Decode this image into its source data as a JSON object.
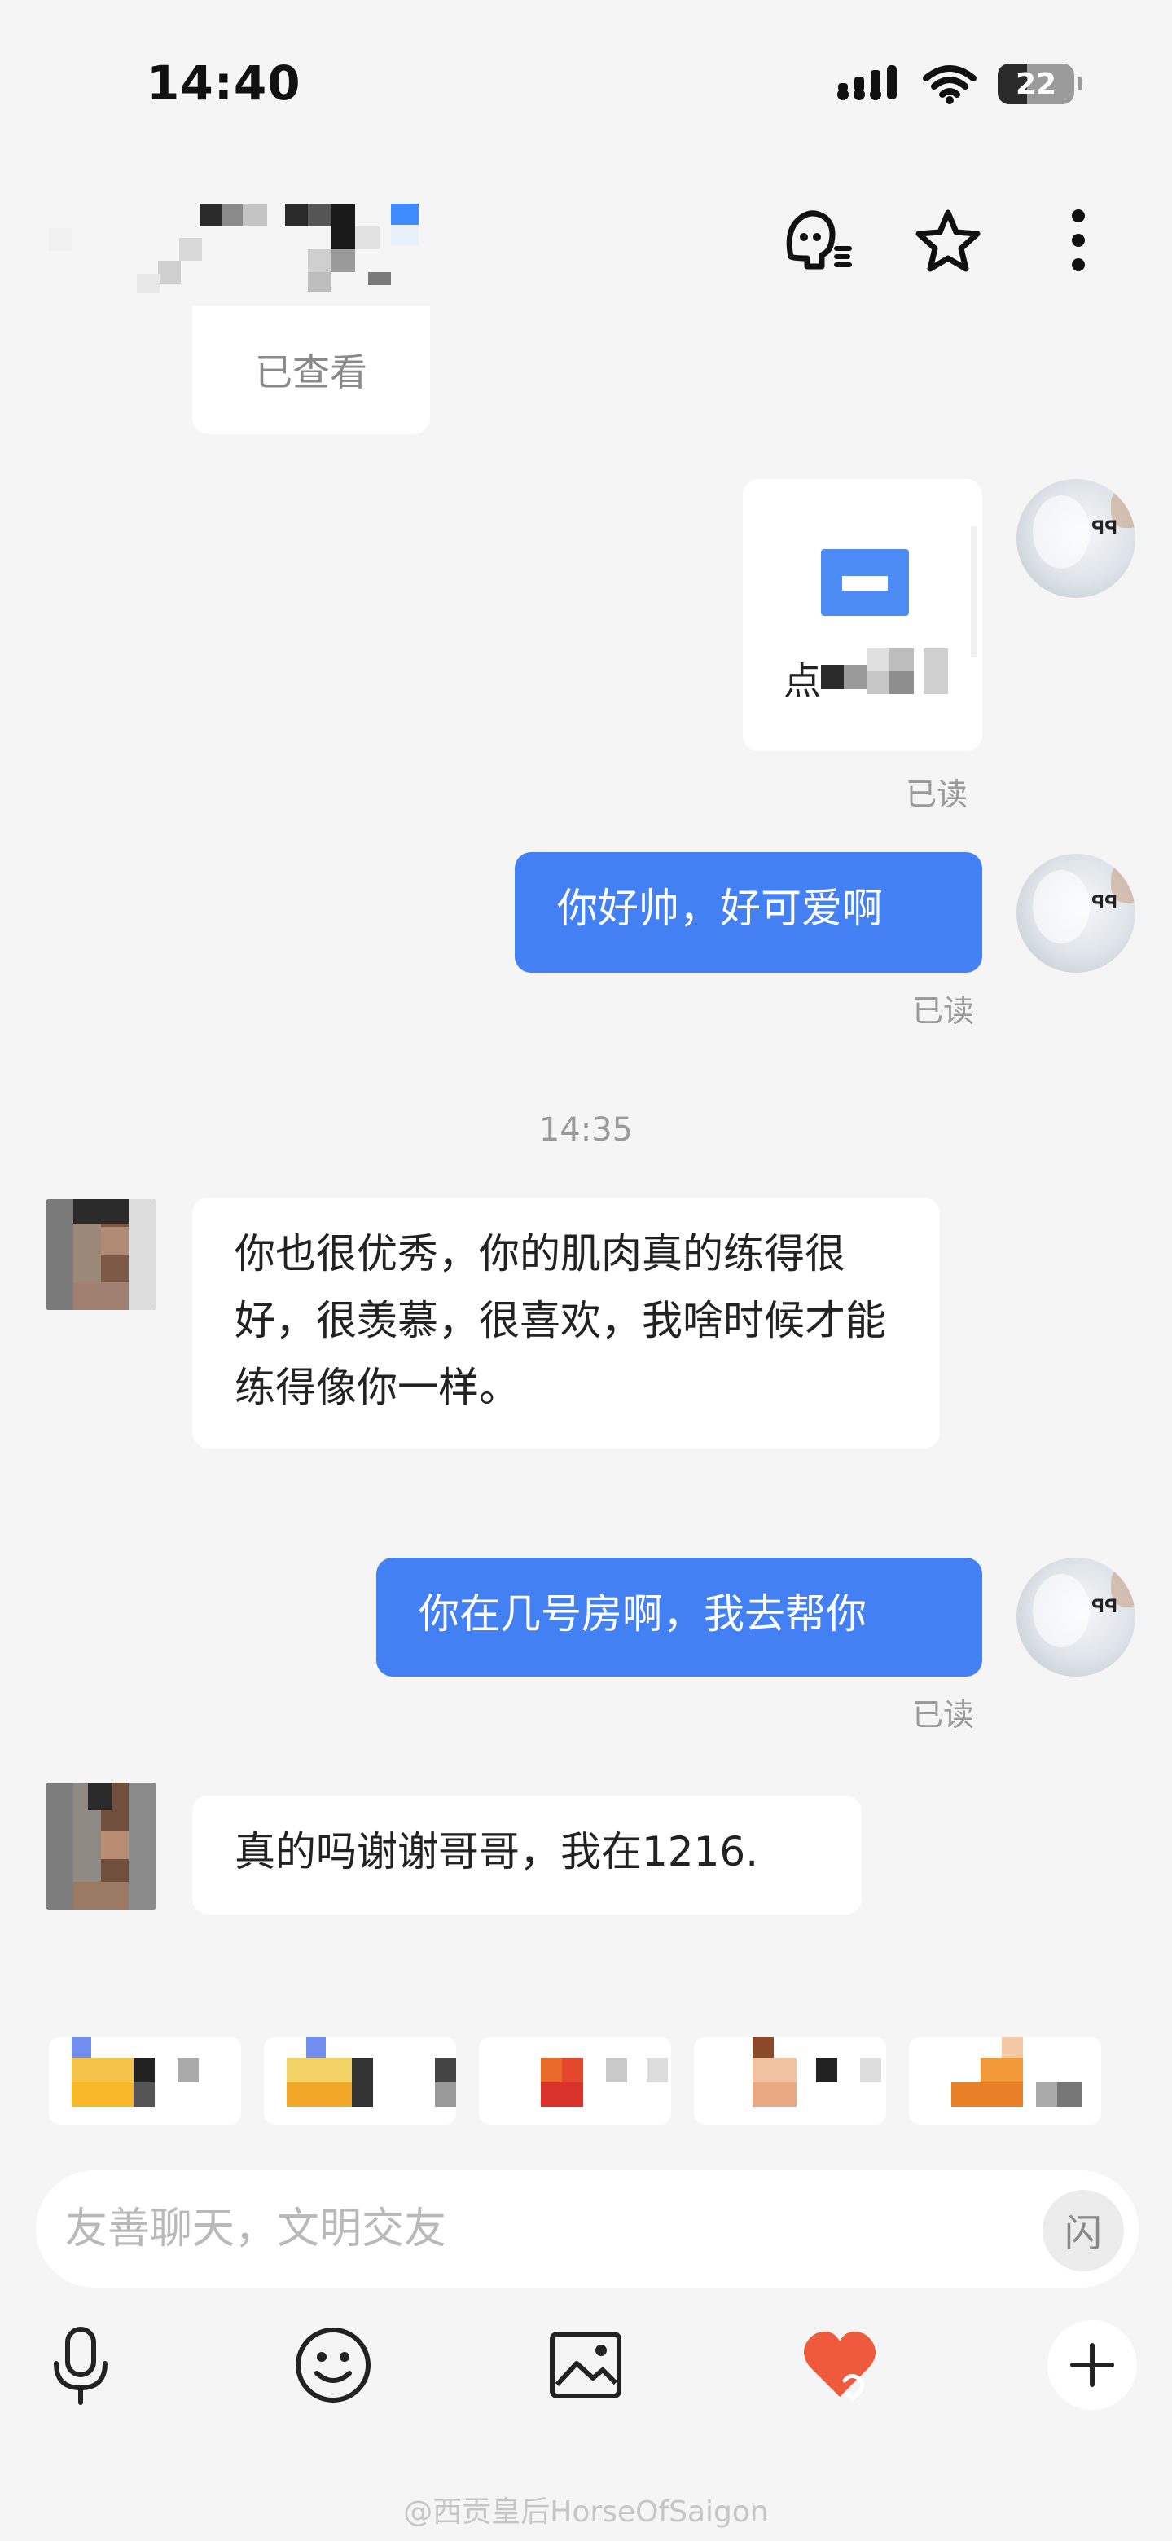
{
  "status_bar": {
    "time": "14:40",
    "battery_level": "22"
  },
  "header": {
    "actions": [
      "tone-icon",
      "star-icon",
      "more-icon"
    ]
  },
  "chat": {
    "viewed_label": "已查看",
    "card_label": "点",
    "read_label": "已读",
    "timestamp": "14:35",
    "messages": [
      {
        "from": "me",
        "text": "你好帅，好可爱啊",
        "status": "已读"
      },
      {
        "from": "them",
        "text": "你也很优秀，你的肌肉真的练得很好，很羡慕，很喜欢，我啥时候才能练得像你一样。"
      },
      {
        "from": "me",
        "text": "你在几号房啊，我去帮你",
        "status": "已读"
      },
      {
        "from": "them",
        "text": "真的吗谢谢哥哥，我在1216."
      }
    ]
  },
  "input": {
    "placeholder": "友善聊天，文明交友",
    "flash_label": "闪"
  },
  "toolbar": {
    "items": [
      "microphone-icon",
      "emoji-icon",
      "image-icon",
      "heart-icon",
      "plus-icon"
    ]
  },
  "watermark": "@西贡皇后HorseOfSaigon",
  "colors": {
    "accent": "#4280f4",
    "background": "#f5f5f5",
    "heart": "#f05a3c"
  }
}
